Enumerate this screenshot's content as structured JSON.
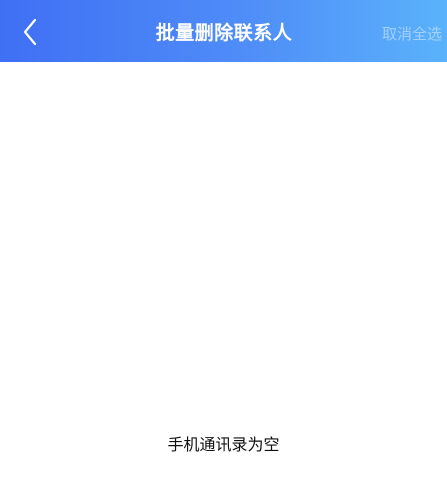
{
  "header": {
    "title": "批量删除联系人",
    "back_icon": "chevron-left-icon",
    "deselect_all_label": "取消全选"
  },
  "colors": {
    "header_gradient_start": "#3f6ff4",
    "header_gradient_end": "#5ab2fb",
    "background": "#ffffff",
    "text": "#111111"
  },
  "main": {
    "empty_message": "手机通讯录为空"
  }
}
